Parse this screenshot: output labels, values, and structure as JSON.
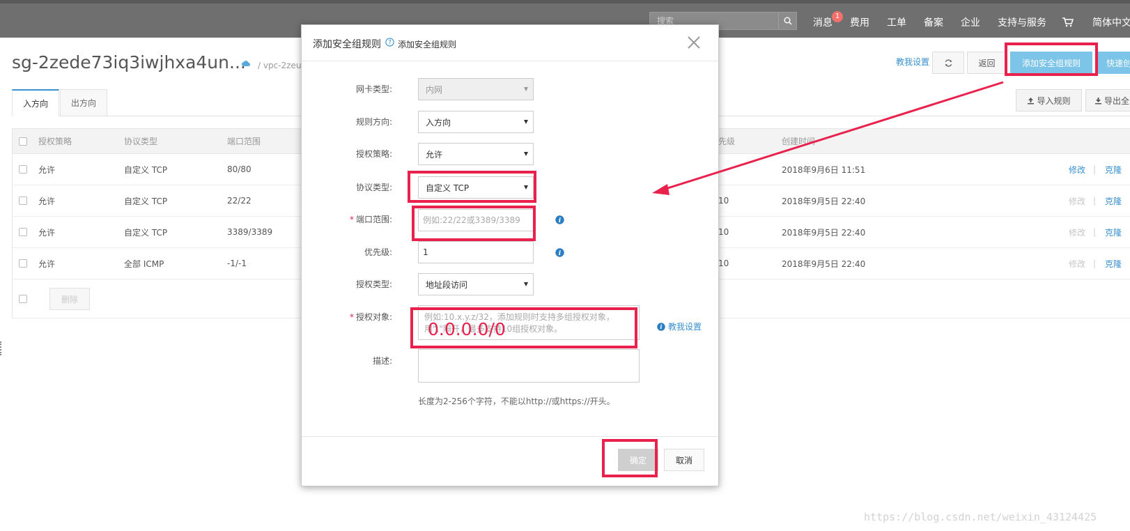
{
  "topbar": {
    "search_placeholder": "搜索",
    "nav": [
      "消息",
      "费用",
      "工单",
      "备案",
      "企业",
      "支持与服务",
      "简体中文"
    ],
    "message_badge": "1"
  },
  "header": {
    "title": "sg-2zede73iq3iwjhxa4un...",
    "vpc": "/ vpc-2zeu",
    "help_link": "教我设置",
    "back_label": "返回",
    "add_rule_label": "添加安全组规则",
    "quick_label": "快速创",
    "import_label": "导入规则",
    "export_label": "导出全"
  },
  "tabs": [
    "入方向",
    "出方向"
  ],
  "table": {
    "headers": {
      "policy": "授权策略",
      "protocol": "协议类型",
      "port": "端口范围",
      "priority": "先级",
      "created": "创建时间"
    },
    "rows": [
      {
        "policy": "允许",
        "protocol": "自定义 TCP",
        "port": "80/80",
        "priority": "",
        "created": "2018年9月6日 11:51",
        "edit": "修改",
        "clone": "克隆",
        "edit_enabled": true
      },
      {
        "policy": "允许",
        "protocol": "自定义 TCP",
        "port": "22/22",
        "priority": "10",
        "created": "2018年9月5日 22:40",
        "edit": "修改",
        "clone": "克隆",
        "edit_enabled": false
      },
      {
        "policy": "允许",
        "protocol": "自定义 TCP",
        "port": "3389/3389",
        "priority": "10",
        "created": "2018年9月5日 22:40",
        "edit": "修改",
        "clone": "克隆",
        "edit_enabled": false
      },
      {
        "policy": "允许",
        "protocol": "全部 ICMP",
        "port": "-1/-1",
        "priority": "10",
        "created": "2018年9月5日 22:40",
        "edit": "修改",
        "clone": "克隆",
        "edit_enabled": false
      }
    ],
    "delete_label": "删除"
  },
  "dialog": {
    "title": "添加安全组规则",
    "subtitle": "添加安全组规则",
    "fields": {
      "nic_type": {
        "label": "网卡类型:",
        "value": "内网"
      },
      "direction": {
        "label": "规则方向:",
        "value": "入方向"
      },
      "policy": {
        "label": "授权策略:",
        "value": "允许"
      },
      "protocol": {
        "label": "协议类型:",
        "value": "自定义 TCP"
      },
      "port_range": {
        "label": "端口范围:",
        "placeholder": "例如:22/22或3389/3389"
      },
      "priority": {
        "label": "优先级:",
        "value": "1"
      },
      "auth_type": {
        "label": "授权类型:",
        "value": "地址段访问"
      },
      "auth_object": {
        "label": "授权对象:",
        "placeholder": "例如:10.x.y.z/32，添加规则时支持多组授权对象，用\",\"隔开，最多支持10组授权对象。"
      },
      "description": {
        "label": "描述:",
        "hint": "长度为2-256个字符，不能以http://或https://开头。"
      }
    },
    "guide_link": "教我设置",
    "confirm_label": "确定",
    "cancel_label": "取消"
  },
  "annotation": {
    "handwritten_value": "0.0.0.0/0",
    "color": "#e8224d"
  },
  "watermark": "https://blog.csdn.net/weixin_43124425"
}
